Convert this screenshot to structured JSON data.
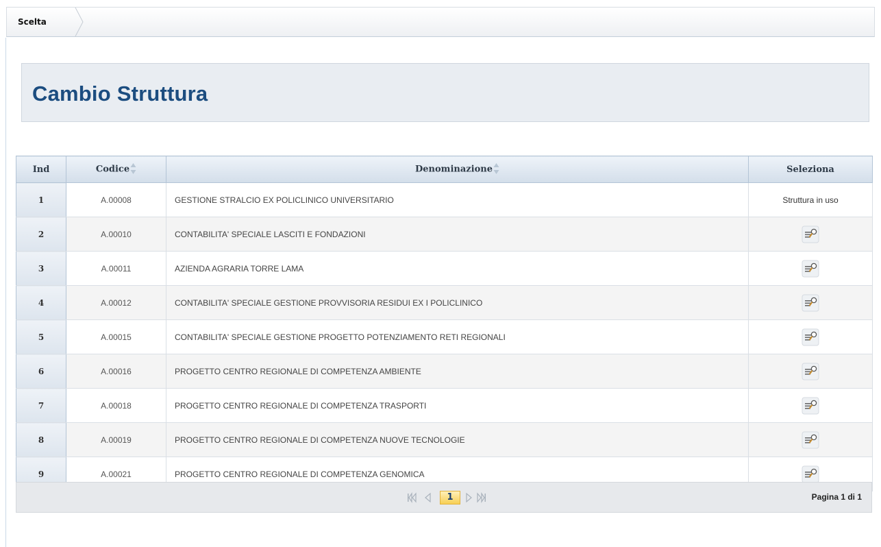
{
  "breadcrumb": {
    "item": "Scelta"
  },
  "page": {
    "title": "Cambio Struttura"
  },
  "table": {
    "headers": {
      "ind": "Ind",
      "codice": "Codice",
      "denominazione": "Denominazione",
      "seleziona": "Seleziona"
    },
    "rows": [
      {
        "ind": "1",
        "codice": "A.00008",
        "denominazione": "GESTIONE STRALCIO EX POLICLINICO UNIVERSITARIO",
        "seleziona": "Struttura in uso"
      },
      {
        "ind": "2",
        "codice": "A.00010",
        "denominazione": "CONTABILITA' SPECIALE LASCITI E FONDAZIONI",
        "seleziona": ""
      },
      {
        "ind": "3",
        "codice": "A.00011",
        "denominazione": "AZIENDA AGRARIA TORRE LAMA",
        "seleziona": ""
      },
      {
        "ind": "4",
        "codice": "A.00012",
        "denominazione": "CONTABILITA' SPECIALE GESTIONE PROVVISORIA RESIDUI EX I POLICLINICO",
        "seleziona": ""
      },
      {
        "ind": "5",
        "codice": "A.00015",
        "denominazione": "CONTABILITA' SPECIALE GESTIONE PROGETTO POTENZIAMENTO RETI REGIONALI",
        "seleziona": ""
      },
      {
        "ind": "6",
        "codice": "A.00016",
        "denominazione": "PROGETTO CENTRO REGIONALE DI COMPETENZA AMBIENTE",
        "seleziona": ""
      },
      {
        "ind": "7",
        "codice": "A.00018",
        "denominazione": "PROGETTO CENTRO REGIONALE DI COMPETENZA TRASPORTI",
        "seleziona": ""
      },
      {
        "ind": "8",
        "codice": "A.00019",
        "denominazione": "PROGETTO CENTRO REGIONALE DI COMPETENZA NUOVE TECNOLOGIE",
        "seleziona": ""
      },
      {
        "ind": "9",
        "codice": "A.00021",
        "denominazione": "PROGETTO CENTRO REGIONALE DI COMPETENZA GENOMICA",
        "seleziona": ""
      }
    ],
    "select_icon": "select-record-icon"
  },
  "pager": {
    "current_page": "1",
    "info": "Pagina 1 di 1"
  },
  "colors": {
    "title": "#1c4d80",
    "header_bg": "#d3deea",
    "page_highlight": "#f7cf55"
  }
}
